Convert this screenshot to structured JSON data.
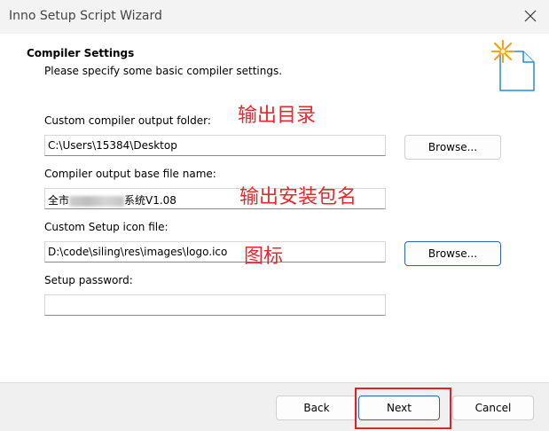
{
  "window": {
    "title": "Inno Setup Script Wizard"
  },
  "section": {
    "title": "Compiler Settings",
    "description": "Please specify some basic compiler settings."
  },
  "fields": {
    "output_folder": {
      "label": "Custom compiler output folder:",
      "value": "C:\\Users\\15384\\Desktop",
      "button": "Browse..."
    },
    "base_file_name": {
      "label": "Compiler output base file name:",
      "value_prefix": "全市",
      "value_suffix": "系统V1.08"
    },
    "icon_file": {
      "label": "Custom Setup icon file:",
      "value": "D:\\code\\siling\\res\\images\\logo.ico",
      "button": "Browse..."
    },
    "password": {
      "label": "Setup password:",
      "value": ""
    }
  },
  "annotations": {
    "output_folder": "输出目录",
    "base_file_name": "输出安装包名",
    "icon_file": "图标"
  },
  "footer": {
    "back": "Back",
    "next": "Next",
    "cancel": "Cancel"
  },
  "colors": {
    "annotation": "#e8282e",
    "focus": "#2a63b8",
    "icon_star": "#f7a21b",
    "icon_page": "#2a8ad6"
  }
}
